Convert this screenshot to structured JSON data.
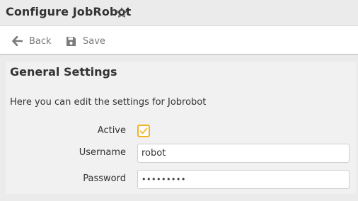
{
  "header": {
    "title": "Configure JobRobot"
  },
  "toolbar": {
    "back_label": "Back",
    "save_label": "Save"
  },
  "section": {
    "title": "General Settings",
    "description": "Here you can edit the settings for Jobrobot"
  },
  "form": {
    "active": {
      "label": "Active",
      "checked": true
    },
    "username": {
      "label": "Username",
      "value": "robot"
    },
    "password": {
      "label": "Password",
      "value": "robotpass"
    }
  },
  "colors": {
    "accent_checkbox": "#f0b323",
    "icon_gray": "#7a7a7a",
    "background": "#ebebeb",
    "panel": "#f1f1f1"
  },
  "icons": {
    "star": "star-outline-icon",
    "back": "arrow-left-icon",
    "save": "floppy-disk-icon",
    "check": "checkmark-icon"
  }
}
